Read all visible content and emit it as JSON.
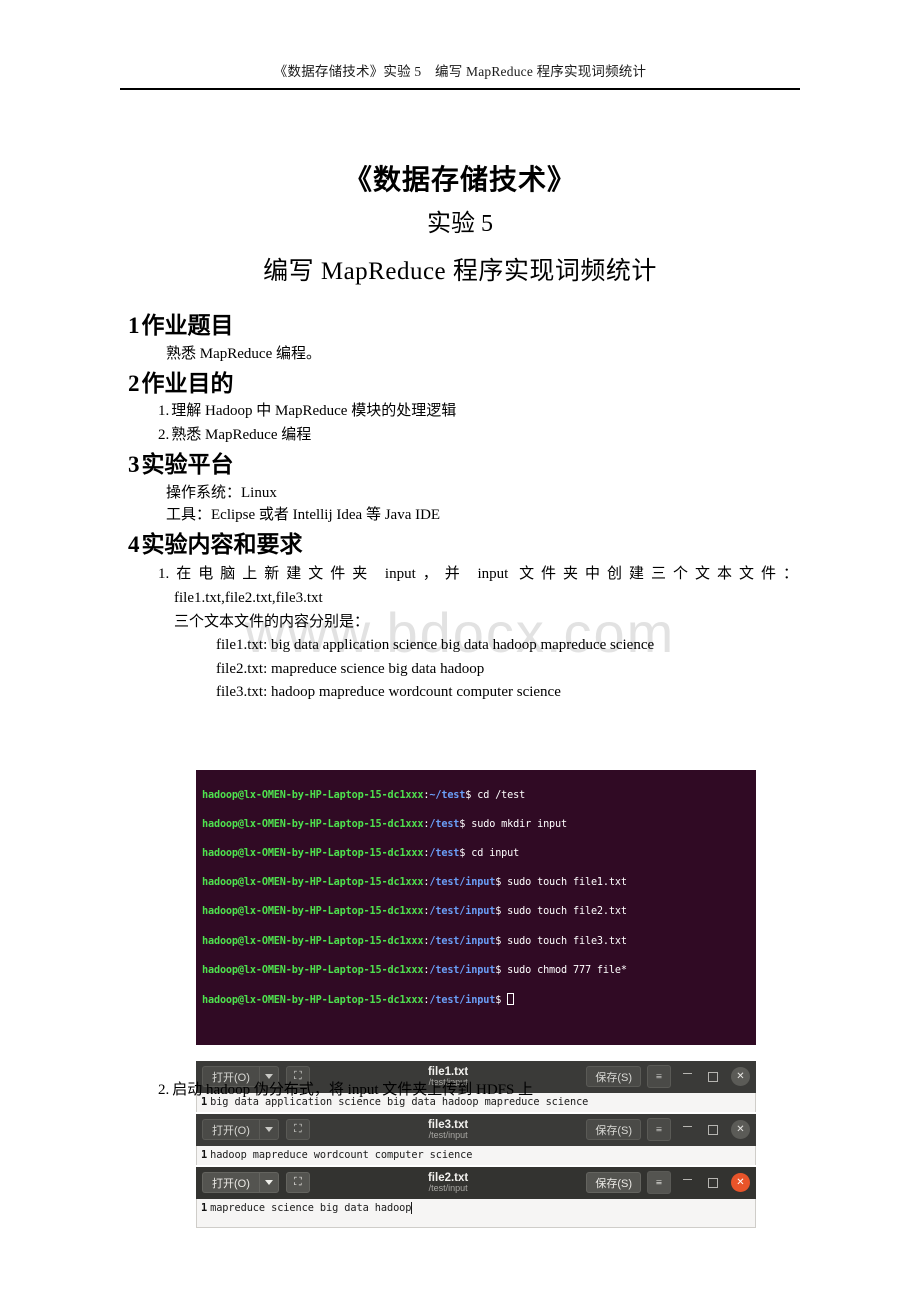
{
  "header": {
    "running_title": "《数据存储技术》实验 5　编写 MapReduce 程序实现词频统计"
  },
  "watermark": "www.bdocx.com",
  "title": {
    "line1": "《数据存储技术》",
    "line2": "实验 5",
    "line3": "编写 MapReduce 程序实现词频统计"
  },
  "sections": [
    {
      "num": "1",
      "heading": "作业题目",
      "lines": [
        "熟悉 MapReduce 编程。"
      ]
    },
    {
      "num": "2",
      "heading": "作业目的",
      "items": [
        {
          "idx": "1.",
          "text": "理解 Hadoop 中 MapReduce 模块的处理逻辑"
        },
        {
          "idx": "2.",
          "text": "熟悉 MapReduce 编程"
        }
      ]
    },
    {
      "num": "3",
      "heading": "实验平台",
      "lines": [
        "操作系统：Linux",
        "工具：Eclipse 或者 Intellij Idea 等 Java IDE"
      ]
    },
    {
      "num": "4",
      "heading": "实验内容和要求"
    }
  ],
  "task1": {
    "idx": "1.",
    "line1": "在电脑上新建文件夹 input，并 input 文件夹中创建三个文本文件：",
    "line2": "file1.txt,file2.txt,file3.txt",
    "line3": "三个文本文件的内容分别是：",
    "files": [
      "file1.txt: big data application science big data hadoop mapreduce science",
      "file2.txt: mapreduce science big data hadoop",
      "file3.txt: hadoop mapreduce wordcount computer science"
    ]
  },
  "task2": {
    "idx": "2.",
    "text": "启动 hadoop 伪分布式，将 input 文件夹上传到 HDFS 上"
  },
  "terminal": {
    "lines": [
      {
        "user": "hadoop@lx-OMEN-by-HP-Laptop-15-dc1xxx",
        "sep": ":",
        "path": "~/test",
        "dollar": "$",
        "cmd": " cd /test"
      },
      {
        "user": "hadoop@lx-OMEN-by-HP-Laptop-15-dc1xxx",
        "sep": ":",
        "path": "/test",
        "dollar": "$",
        "cmd": " sudo mkdir input"
      },
      {
        "user": "hadoop@lx-OMEN-by-HP-Laptop-15-dc1xxx",
        "sep": ":",
        "path": "/test",
        "dollar": "$",
        "cmd": " cd input"
      },
      {
        "user": "hadoop@lx-OMEN-by-HP-Laptop-15-dc1xxx",
        "sep": ":",
        "path": "/test/input",
        "dollar": "$",
        "cmd": " sudo touch file1.txt"
      },
      {
        "user": "hadoop@lx-OMEN-by-HP-Laptop-15-dc1xxx",
        "sep": ":",
        "path": "/test/input",
        "dollar": "$",
        "cmd": " sudo touch file2.txt"
      },
      {
        "user": "hadoop@lx-OMEN-by-HP-Laptop-15-dc1xxx",
        "sep": ":",
        "path": "/test/input",
        "dollar": "$",
        "cmd": " sudo touch file3.txt"
      },
      {
        "user": "hadoop@lx-OMEN-by-HP-Laptop-15-dc1xxx",
        "sep": ":",
        "path": "/test/input",
        "dollar": "$",
        "cmd": " sudo chmod 777 file*"
      },
      {
        "user": "hadoop@lx-OMEN-by-HP-Laptop-15-dc1xxx",
        "sep": ":",
        "path": "/test/input",
        "dollar": "$",
        "cmd": " "
      }
    ],
    "colors": {
      "background": "#300a24",
      "user": "#4ee24e",
      "path": "#6a9ef7",
      "text": "#ffffff"
    }
  },
  "editors": [
    {
      "open_label": "打开(O)",
      "new_label": "＋",
      "save_label": "保存(S)",
      "menu_label": "≡",
      "title": "file1.txt",
      "subtitle": "/test/input",
      "line_number": "1",
      "content": "big data application science big data hadoop mapreduce science",
      "active": false
    },
    {
      "open_label": "打开(O)",
      "new_label": "＋",
      "save_label": "保存(S)",
      "menu_label": "≡",
      "title": "file3.txt",
      "subtitle": "/test/input",
      "line_number": "1",
      "content": "hadoop mapreduce wordcount computer science",
      "active": false
    },
    {
      "open_label": "打开(O)",
      "new_label": "＋",
      "save_label": "保存(S)",
      "menu_label": "≡",
      "title": "file2.txt",
      "subtitle": "/test/input",
      "line_number": "1",
      "content": "mapreduce science big data hadoop",
      "active": true
    }
  ],
  "colors": {
    "titlebar_inactive": "#3a3a38",
    "titlebar_active": "#333330",
    "close_active": "#e8542a",
    "doc_background": "#f6f5f4",
    "watermark": "#e2e2e2"
  }
}
